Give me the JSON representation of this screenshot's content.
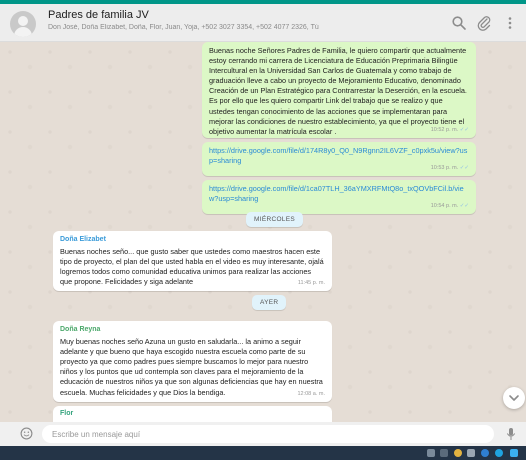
{
  "header": {
    "title": "Padres de familia JV",
    "subtitle": "Don José, Doña Elizabet, Doña, Flor, Juan, Yoja, +502 3027 3354, +502 4077 2326, Tú"
  },
  "messages": {
    "m1": {
      "text": "Buenas noche Señores Padres de Familia, le quiero compartir que actualmente estoy cerrando mi carrera de Licenciatura de Educación Preprimaria Bilingüe Intercultural en la Universidad San Carlos de Guatemala y como trabajo de graduación lleve a cabo un proyecto de Mejoramiento Educativo, denominado Creación de un Plan Estratégico para Contrarrestar la Deserción, en la escuela. Es por ello que les quiero compartir Link del trabajo que se realizo y que ustedes tengan conocimiento de las acciones que se implementaran para mejorar las condiciones de nuestro establecimiento, ya que el proyecto tiene el objetivo aumentar la matrícula escolar .",
      "time": "10:52 p. m."
    },
    "m2": {
      "text": "https://drive.google.com/file/d/174R8y0_Q0_N9Rgnn2IL6VZF_c0pxk5u/view?usp=sharing",
      "time": "10:53 p. m."
    },
    "m3": {
      "text": "https://drive.google.com/file/d/1ca07TLH_36aYMXRFMtQ8o_txQOVbFCil.b/view?usp=sharing",
      "time": "10:54 p. m."
    },
    "date1": "MIÉRCOLES",
    "m4": {
      "sender": "Doña Elizabet",
      "text": "Buenas noches seño... que gusto saber que ustedes como maestros hacen este tipo de proyecto, el plan del que usted habla en el video es muy interesante, ojalá logremos todos como comunidad educativa unimos para realizar las acciones que propone. Felicidades y siga adelante",
      "time": "11:45 p. m."
    },
    "date2": "AYER",
    "m5": {
      "sender": "Doña Reyna",
      "text": "Muy buenas noches seño Azuna un gusto en saludarla... la animo a seguir adelante y que bueno que haya escogido nuestra escuela como parte de su proyecto ya que como padres pues siempre buscamos lo mejor para nuestro niños y los puntos que ud contempla son claves para el mejoramiento de la educación de nuestros niños ya que son algunas deficiencias que hay en nuestra escuela. Muchas felicidades y que Dios la bendiga.",
      "time": "12:08 a. m."
    },
    "m6": {
      "sender": "Flor"
    }
  },
  "input": {
    "placeholder": "Escribe un mensaje aquí"
  },
  "icons": {
    "search": "search-icon",
    "attach": "paperclip-icon",
    "menu": "menu-icon",
    "emoji": "emoji-icon",
    "mic": "mic-icon",
    "scroll": "chevron-down-icon"
  },
  "colors": {
    "accent": "#009688",
    "outgoing": "#dcf8c6",
    "incoming": "#ffffff",
    "chat_bg": "#e5ddd5",
    "link": "#2a8bd6",
    "sender_elizabet": "#3a9bd9",
    "sender_reyna": "#4ca86b",
    "sender_flor": "#35a37d"
  }
}
